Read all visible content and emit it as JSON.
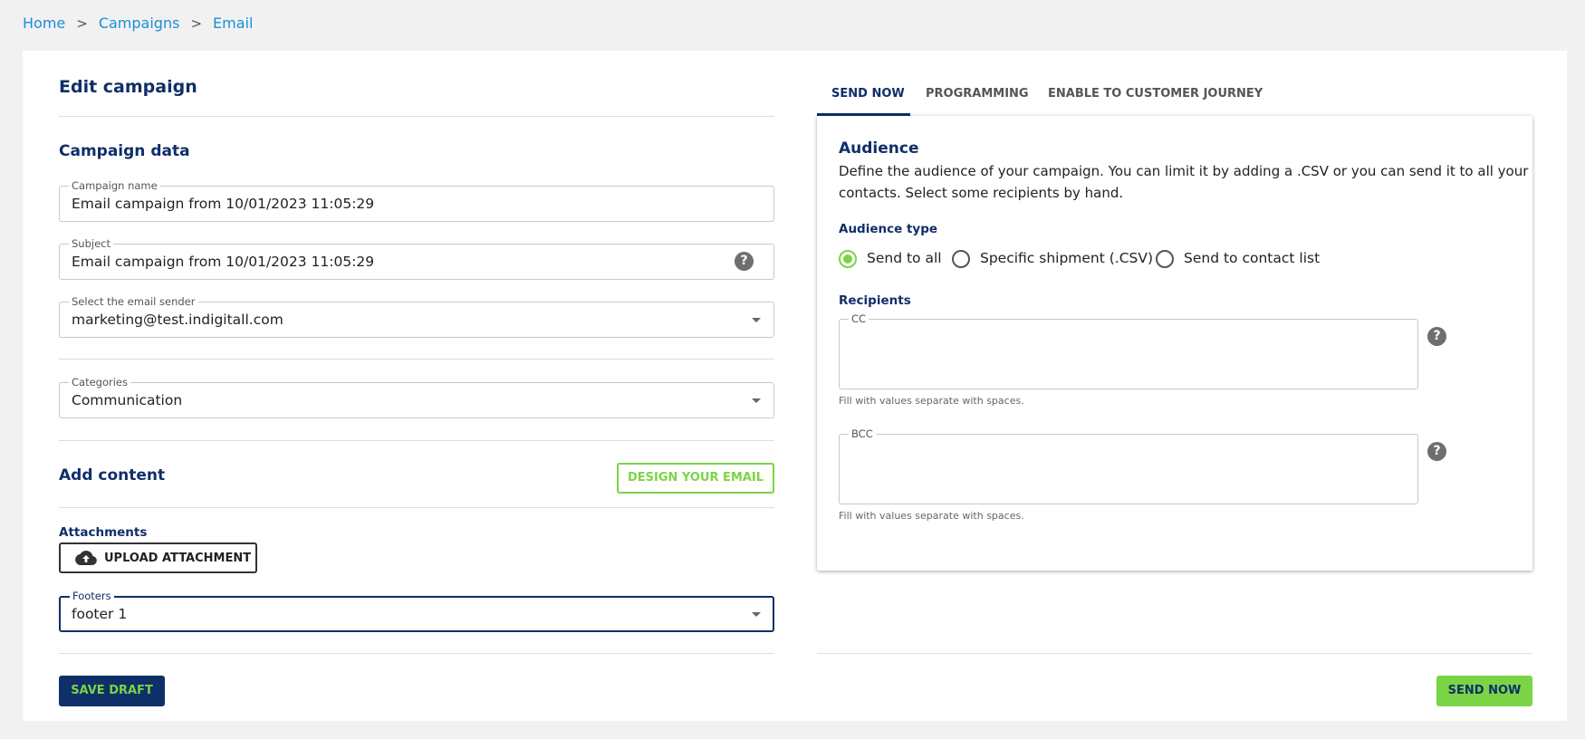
{
  "breadcrumb": {
    "home": "Home",
    "campaigns": "Campaigns",
    "email": "Email",
    "separator": ">"
  },
  "left": {
    "title": "Edit campaign",
    "campaign_data_title": "Campaign data",
    "campaign_name": {
      "label": "Campaign name",
      "value": "Email campaign from  10/01/2023 11:05:29"
    },
    "subject": {
      "label": "Subject",
      "value": "Email campaign from  10/01/2023 11:05:29",
      "help": "?"
    },
    "sender": {
      "label": "Select the email sender",
      "value": "marketing@test.indigitall.com"
    },
    "categories": {
      "label": "Categories",
      "value": "Communication"
    },
    "add_content_title": "Add content",
    "design_button": "DESIGN YOUR EMAIL",
    "attachments_title": "Attachments",
    "upload_button": "UPLOAD ATTACHMENT",
    "footers": {
      "label": "Footers",
      "value": "footer 1"
    },
    "save_draft": "SAVE DRAFT"
  },
  "tabs": [
    {
      "label": "SEND NOW"
    },
    {
      "label": "PROGRAMMING"
    },
    {
      "label": "ENABLE TO CUSTOMER JOURNEY"
    }
  ],
  "audience": {
    "title": "Audience",
    "description_line1": "Define the audience of your campaign. You can limit it by adding a .CSV or you can send it to all your",
    "description_line2": "contacts. Select some recipients by hand.",
    "type_title": "Audience type",
    "options": [
      {
        "label": "Send to all",
        "selected": true
      },
      {
        "label": "Specific shipment (.CSV)",
        "selected": false
      },
      {
        "label": "Send to contact list",
        "selected": false
      }
    ],
    "recipients_title": "Recipients",
    "cc": {
      "label": "CC",
      "value": "",
      "hint": "Fill with values separate with spaces.",
      "help": "?"
    },
    "bcc": {
      "label": "BCC",
      "value": "",
      "hint": "Fill with values separate with spaces.",
      "help": "?"
    }
  },
  "send_now": "SEND NOW",
  "colors": {
    "navy": "#0f2f68",
    "green": "#7bd445",
    "link": "#1a8fd6"
  }
}
